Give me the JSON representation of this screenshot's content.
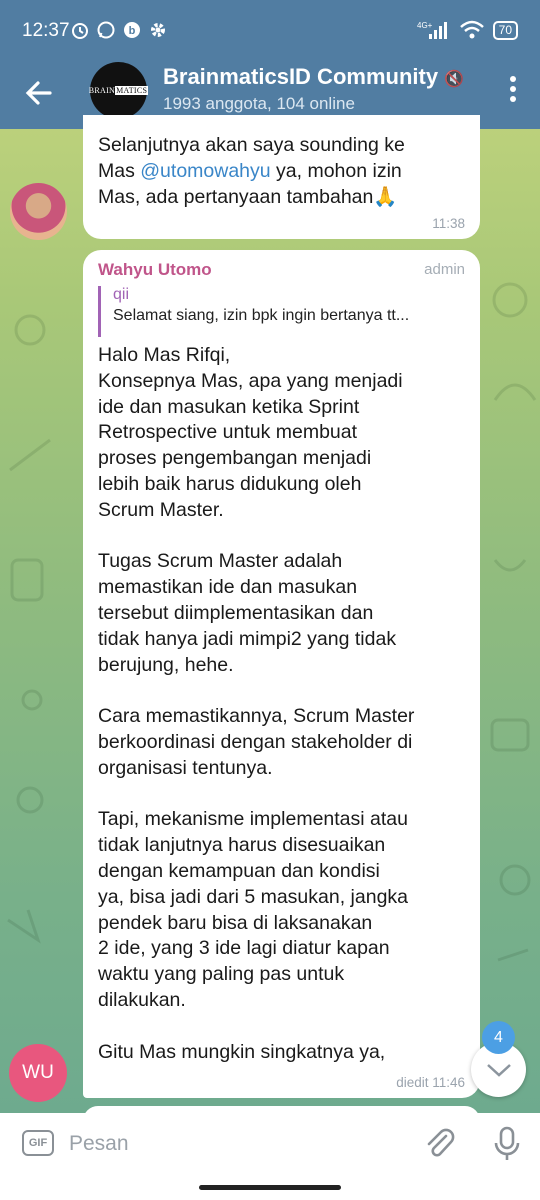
{
  "status_bar": {
    "time": "12:37",
    "battery": "70",
    "network": "4G+",
    "icons": [
      "alarm-icon",
      "whatsapp-icon",
      "app-notification-icon",
      "settings-icon"
    ]
  },
  "header": {
    "title": "BrainmaticsID Community",
    "subtitle": "1993 anggota, 104 online",
    "avatar_logo_left": "BRAIN",
    "avatar_logo_right": "MATICS"
  },
  "messages": [
    {
      "text_before": "Selanjutnya akan saya sounding ke\nMas ",
      "mention": "@utomowahyu",
      "text_after": " ya, mohon izin\nMas, ada pertanyaan tambahan🙏",
      "time": "11:38"
    },
    {
      "sender": "Wahyu Utomo",
      "role": "admin",
      "reply_name": "qii",
      "reply_text": "Selamat siang, izin bpk ingin bertanya tt...",
      "text": "Halo Mas Rifqi,\nKonsepnya Mas, apa yang menjadi\nide dan masukan ketika Sprint\nRetrospective untuk membuat\nproses pengembangan menjadi\nlebih baik harus didukung oleh\nScrum Master.\n\nTugas Scrum Master adalah\nmemastikan ide dan masukan\ntersebut diimplementasikan dan\ntidak hanya jadi mimpi2 yang tidak\nberujung, hehe.\n\nCara memastikannya, Scrum Master\nberkoordinasi dengan stakeholder di\norganisasi tentunya.\n\nTapi, mekanisme implementasi atau\ntidak lanjutnya harus disesuaikan\ndengan kemampuan dan kondisi\nya, bisa jadi dari 5 masukan, jangka\npendek baru bisa di laksanakan\n2 ide, yang 3 ide lagi diatur kapan\nwaktu yang paling pas untuk\ndilakukan.\n\nGitu Mas mungkin singkatnya ya,",
      "time": "diedit 11:46",
      "avatar_initials": "WU"
    }
  ],
  "unread_count": "4",
  "composer": {
    "gif_label": "GIF",
    "placeholder": "Pesan"
  },
  "colors": {
    "header": "#517da2",
    "sender_name": "#c0558a",
    "reply_accent": "#a163b5",
    "mention": "#3a86c8",
    "wu_avatar": "#e8577e",
    "badge": "#4c9fe4"
  }
}
